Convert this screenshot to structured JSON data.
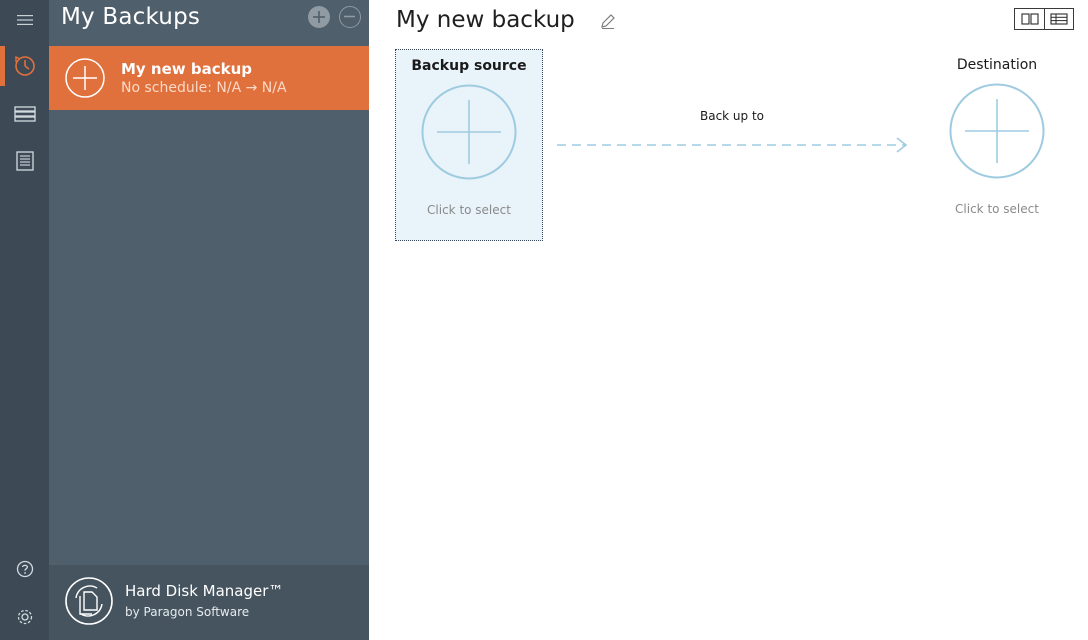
{
  "rail": {
    "items": [
      {
        "name": "menu-icon"
      },
      {
        "name": "backup-clock-icon",
        "active": true
      },
      {
        "name": "disks-icon"
      },
      {
        "name": "log-list-icon"
      },
      {
        "name": "help-icon"
      },
      {
        "name": "settings-gear-icon"
      }
    ]
  },
  "panel": {
    "title": "My Backups",
    "items": [
      {
        "name": "My new backup",
        "schedule": "No schedule: N/A → N/A"
      }
    ],
    "footer": {
      "product": "Hard Disk Manager™",
      "vendor": "by Paragon Software"
    }
  },
  "main": {
    "title": "My new backup",
    "source": {
      "label": "Backup source",
      "hint": "Click to select"
    },
    "arrow_label": "Back up to",
    "destination": {
      "label": "Destination",
      "hint": "Click to select"
    }
  },
  "colors": {
    "accent": "#e0703c",
    "rail": "#3d4a55",
    "panel": "#4f5f6b",
    "circle": "#9fcbe0",
    "source_bg": "#e8f3fa"
  }
}
